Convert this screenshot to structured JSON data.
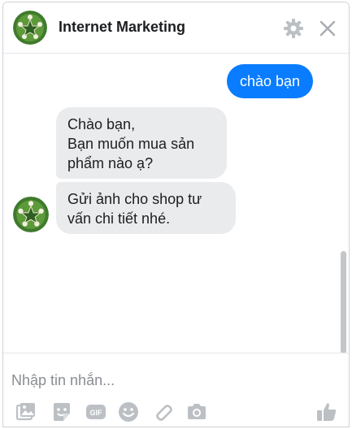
{
  "header": {
    "title": "Internet Marketing",
    "avatar_icon": "page-avatar",
    "settings_icon": "gear-icon",
    "close_icon": "close-icon"
  },
  "messages": {
    "outgoing": [
      {
        "text": "chào bạn"
      }
    ],
    "incoming": [
      {
        "lines": [
          "Chào bạn,",
          "Bạn muốn mua sản",
          "phẩm nào ạ?"
        ]
      },
      {
        "lines": [
          "Gửi ảnh cho shop tư",
          "vấn chi tiết nhé."
        ]
      }
    ]
  },
  "composer": {
    "placeholder": "Nhập tin nhắn...",
    "value": "",
    "tools": [
      "image-icon",
      "sticker-icon",
      "gif-icon",
      "emoji-icon",
      "attachment-icon",
      "camera-icon",
      "like-icon"
    ]
  },
  "colors": {
    "accent": "#0a7cff",
    "incoming_bubble": "#eaebed",
    "icon_gray": "#bcc0c4"
  }
}
